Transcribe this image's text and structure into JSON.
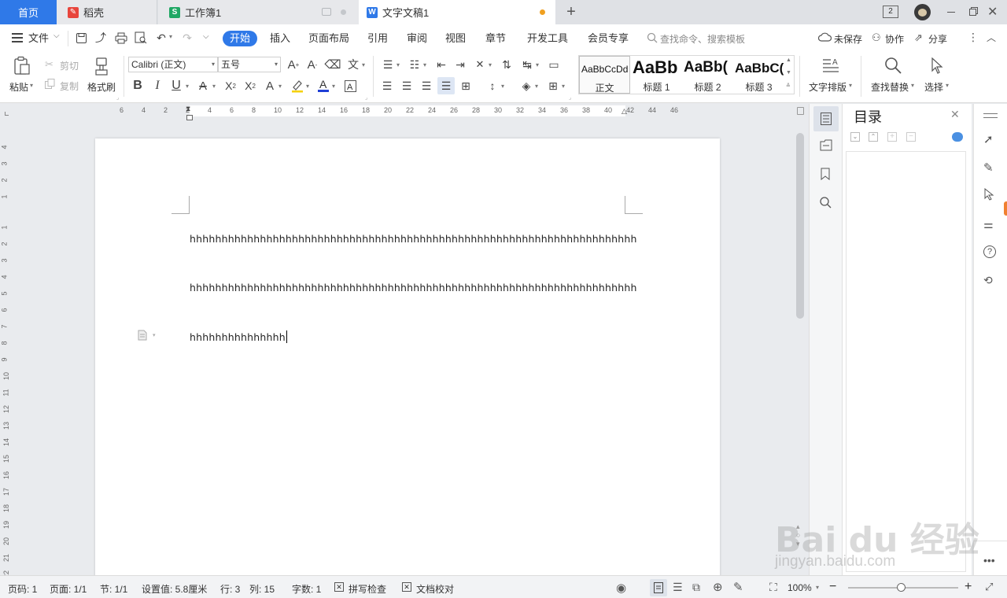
{
  "tabs": {
    "home": "首页",
    "daoke": "稻壳",
    "workbook": "工作簿1",
    "document": "文字文稿1",
    "new_tab": "+",
    "window_count": "2"
  },
  "menu": {
    "file": "文件",
    "tabs": [
      "开始",
      "插入",
      "页面布局",
      "引用",
      "审阅",
      "视图",
      "章节",
      "开发工具",
      "会员专享"
    ],
    "search_placeholder": "查找命令、搜索模板",
    "unsaved": "未保存",
    "collaborate": "协作",
    "share": "分享"
  },
  "ribbon": {
    "paste": "粘贴",
    "cut": "剪切",
    "copy": "复制",
    "format_painter": "格式刷",
    "font_name": "Calibri (正文)",
    "font_size": "五号",
    "text_layout": "文字排版",
    "find_replace": "查找替换",
    "select": "选择"
  },
  "styles": [
    {
      "sample": "AaBbCcDd",
      "name": "正文"
    },
    {
      "sample": "AaBb",
      "name": "标题 1"
    },
    {
      "sample": "AaBb(",
      "name": "标题 2"
    },
    {
      "sample": "AaBbC(",
      "name": "标题 3"
    }
  ],
  "ruler": {
    "horizontal": [
      "6",
      "4",
      "2",
      "2",
      "4",
      "6",
      "8",
      "10",
      "12",
      "14",
      "16",
      "18",
      "20",
      "22",
      "24",
      "26",
      "28",
      "30",
      "32",
      "34",
      "36",
      "38",
      "40",
      "42",
      "44",
      "46"
    ],
    "vertical": [
      "4",
      "3",
      "2",
      "1",
      "1",
      "2",
      "3",
      "4",
      "5",
      "6",
      "7",
      "8",
      "9",
      "10",
      "11",
      "12",
      "13",
      "14",
      "15",
      "16",
      "17",
      "18",
      "19",
      "20",
      "21",
      "22"
    ]
  },
  "document": {
    "lines": [
      "hhhhhhhhhhhhhhhhhhhhhhhhhhhhhhhhhhhhhhhhhhhhhhhhhhhhhhhhhhhhhhhhhhhhhh",
      "hhhhhhhhhhhhhhhhhhhhhhhhhhhhhhhhhhhhhhhhhhhhhhhhhhhhhhhhhhhhhhhhhhhhhh",
      "hhhhhhhhhhhhhhh"
    ]
  },
  "toc": {
    "title": "目录"
  },
  "statusbar": {
    "page_no": "页码: 1",
    "pages": "页面: 1/1",
    "section": "节: 1/1",
    "setting": "设置值: 5.8厘米",
    "row": "行: 3",
    "col": "列: 15",
    "word_count": "字数: 1",
    "spell_check": "拼写检查",
    "doc_proof": "文档校对",
    "zoom": "100%"
  },
  "colors": {
    "accent": "#2f79e8",
    "tab_modified_dot": "#f0a020"
  },
  "watermark": {
    "brand": "Bai du 经验",
    "url": "jingyan.baidu.com"
  }
}
